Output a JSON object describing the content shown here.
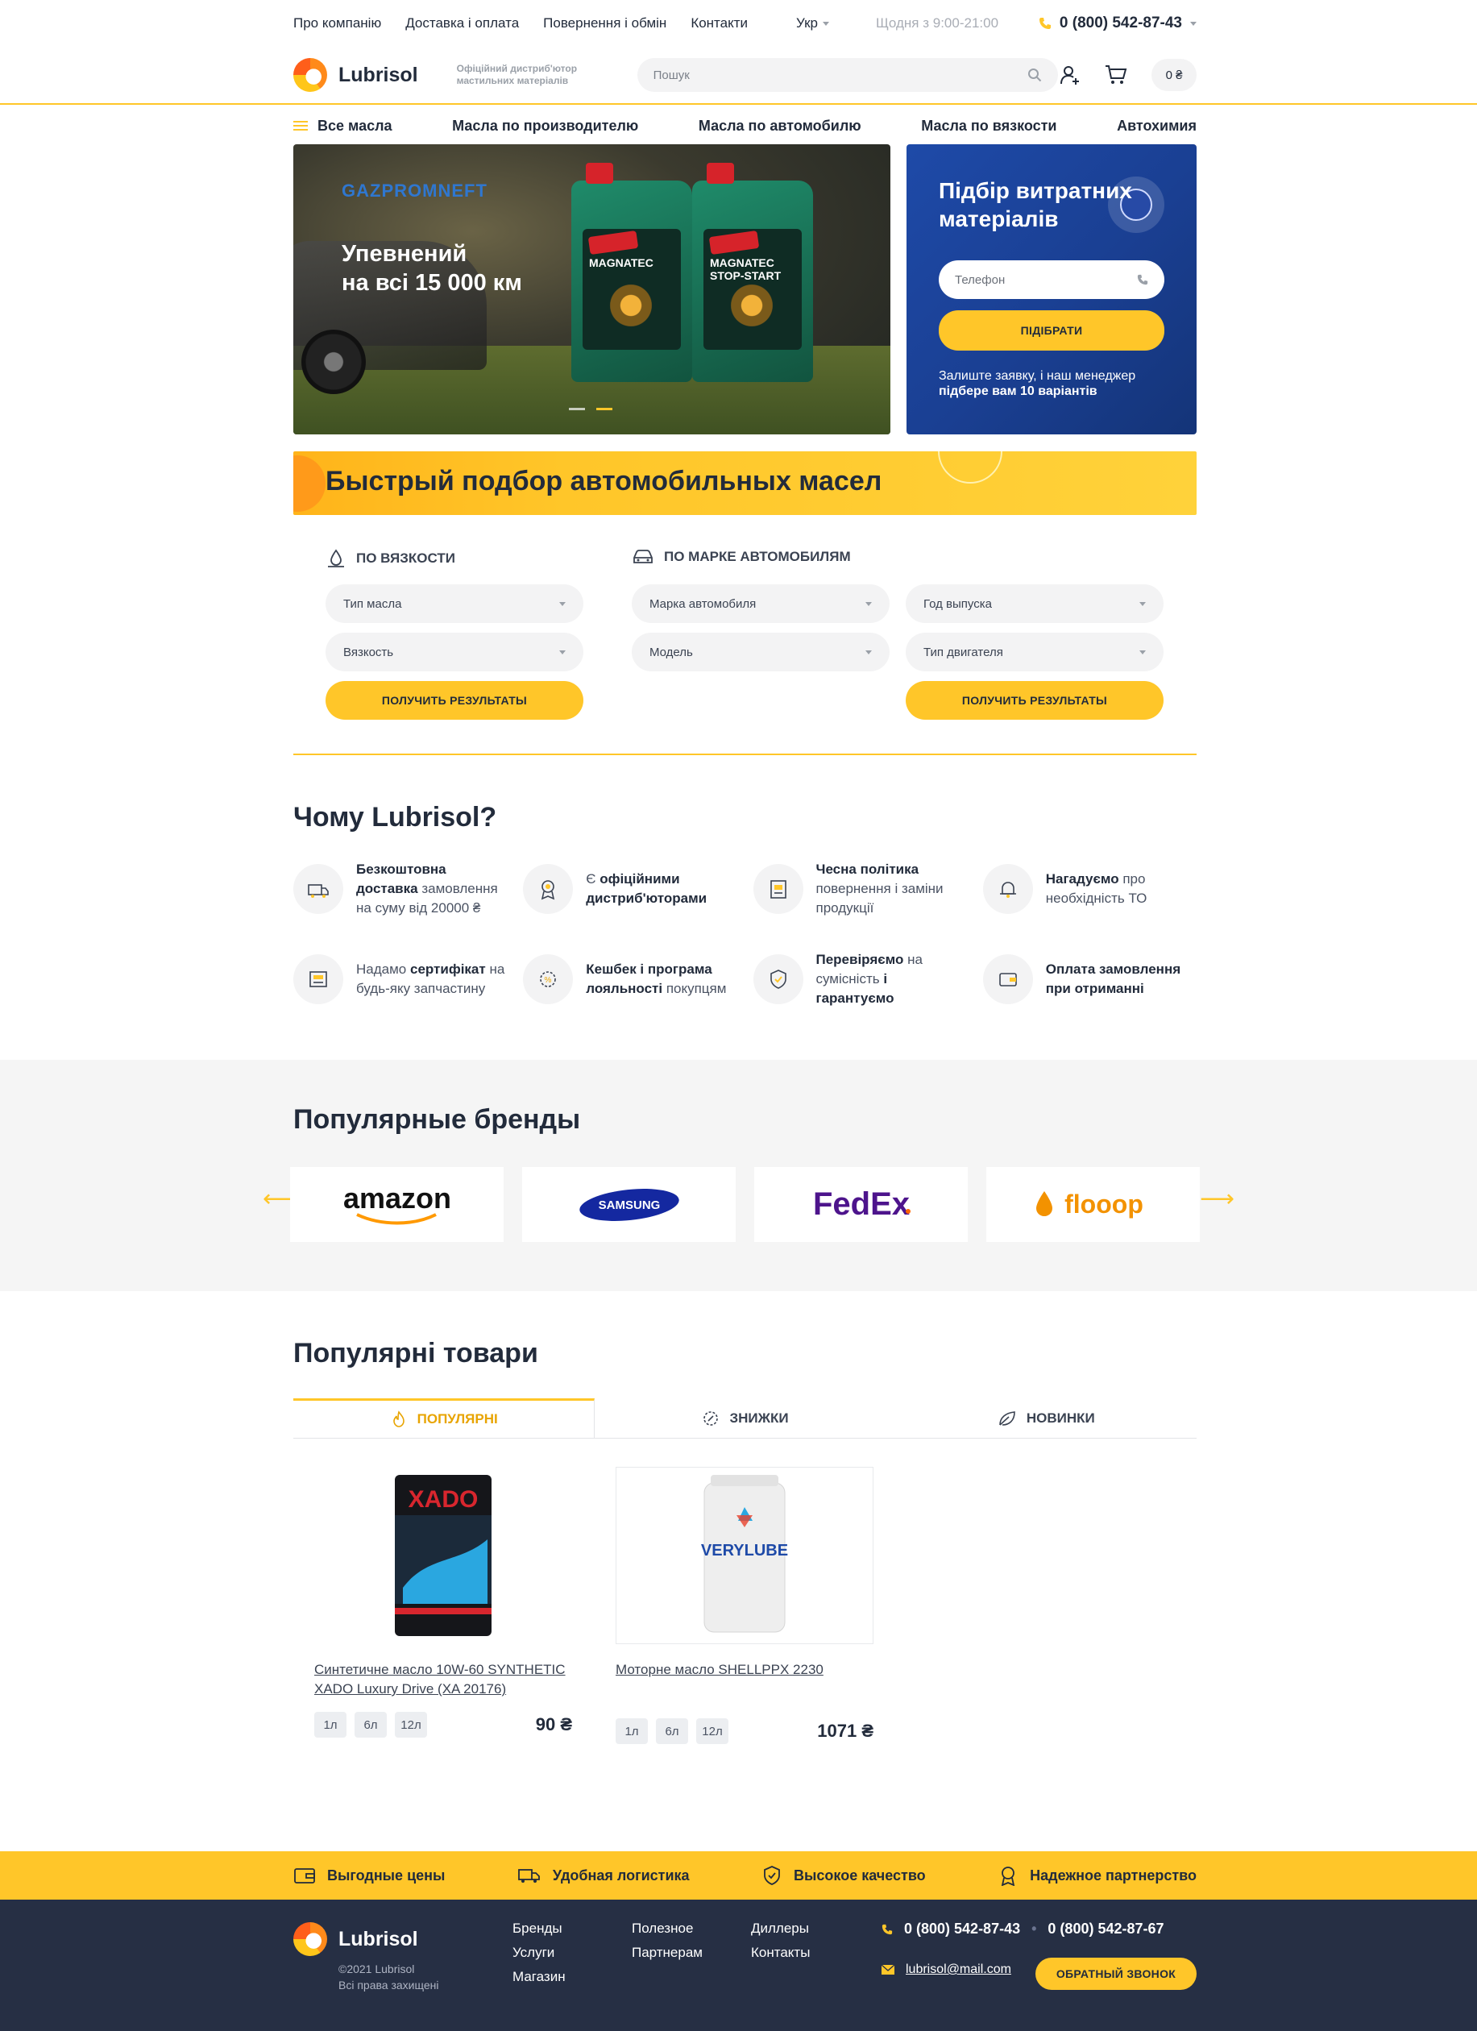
{
  "topbar": {
    "links": [
      "Про компанію",
      "Доставка і оплата",
      "Повернення і обмін",
      "Контакти"
    ],
    "language": "Укр",
    "hours": "Щодня з 9:00-21:00",
    "phone": "0 (800) 542-87-43"
  },
  "header": {
    "logo": "Lubrisol",
    "tagline": "Офіційний дистриб'ютор мастильних матеріалів",
    "search_placeholder": "Пошук",
    "cart_total": "0 ₴"
  },
  "nav": {
    "all": "Все масла",
    "items": [
      "Масла по производителю",
      "Масла по автомобилю",
      "Масла по вязкости",
      "Автохимия"
    ]
  },
  "hero": {
    "brand": "GAZPROMNEFT",
    "slogan_line1": "Упевнений",
    "slogan_line2": "на всі 15 000 км",
    "can1": "MAGNATEC",
    "can2": "MAGNATEC STOP-START"
  },
  "selector": {
    "title": "Підбір витратних матеріалів",
    "phone_placeholder": "Телефон",
    "button": "ПІДІБРАТИ",
    "note_text": "Залиште заявку, і наш менеджер",
    "note_bold": "підбере вам 10 варіантів"
  },
  "quick": {
    "title": "Быстрый подбор автомобильных масел"
  },
  "filters": {
    "viscosity_title": "ПО ВЯЗКОСТИ",
    "brand_title": "ПО МАРКЕ АВТОМОБИЛЯМ",
    "oil_type": "Тип масла",
    "viscosity": "Вязкость",
    "car_brand": "Марка автомобиля",
    "model": "Модель",
    "year": "Год выпуска",
    "engine": "Тип двигателя",
    "button": "ПОЛУЧИТЬ РЕЗУЛЬТАТЫ"
  },
  "why": {
    "title": "Чому Lubrisol?",
    "features": [
      {
        "b1": "Безкоштовна доставка",
        "t": " замовлення на суму від 20000 ₴",
        "icon": "delivery-icon"
      },
      {
        "t0": "Є ",
        "b1": "офіційними дистриб'юторами",
        "icon": "award-icon"
      },
      {
        "b1": "Чесна політика",
        "t": " повернення і заміни продукції",
        "icon": "document-icon"
      },
      {
        "b1": "Нагадуємо",
        "t": " про необхідність ТО",
        "icon": "bell-icon"
      },
      {
        "t0": "Надамо ",
        "b1": "сертифікат",
        "t": " на будь-яку запчастину",
        "icon": "certificate-icon"
      },
      {
        "b1": "Кешбек і програма лояльності",
        "t": " покупцям",
        "icon": "cashback-icon"
      },
      {
        "b1": "Перевіряємо",
        "t": " на сумісність ",
        "b2": "і гарантуємо",
        "icon": "shield-icon"
      },
      {
        "b1": "Оплата замовлення при отриманні",
        "icon": "wallet-icon"
      }
    ]
  },
  "brands": {
    "title": "Популярные бренды",
    "items": [
      "amazon",
      "SAMSUNG",
      "FedEx",
      "flooop"
    ]
  },
  "products": {
    "title": "Популярні товари",
    "tabs": [
      "ПОПУЛЯРНІ",
      "ЗНИЖКИ",
      "НОВИНКИ"
    ],
    "items": [
      {
        "name": "Синтетичне масло 10W-60 SYNTHETIC XADO Luxury Drive (XA 20176)",
        "volumes": [
          "1л",
          "6л",
          "12л"
        ],
        "price": "90 ₴",
        "label": "XADO"
      },
      {
        "name": "Моторне масло SHELLPPX 2230",
        "volumes": [
          "1л",
          "6л",
          "12л"
        ],
        "price": "1071 ₴",
        "label": "VERYLUBE"
      }
    ]
  },
  "advantages": [
    "Выгодные цены",
    "Удобная логистика",
    "Высокое качество",
    "Надежное партнерство"
  ],
  "footer": {
    "logo": "Lubrisol",
    "copyright": "©2021 Lubrisol",
    "rights": "Всі права захищені",
    "col1": [
      "Бренды",
      "Услуги",
      "Магазин"
    ],
    "col2": [
      "Полезное",
      "Партнерам"
    ],
    "col3": [
      "Диллеры",
      "Контакты"
    ],
    "phone1": "0 (800) 542-87-43",
    "phone2": "0 (800) 542-87-67",
    "email": "lubrisol@mail.com",
    "callback": "ОБРАТНЫЙ ЗВОНОК"
  },
  "colors": {
    "accent": "#ffc629",
    "dark": "#262f44",
    "blue": "#1e4aa8"
  }
}
